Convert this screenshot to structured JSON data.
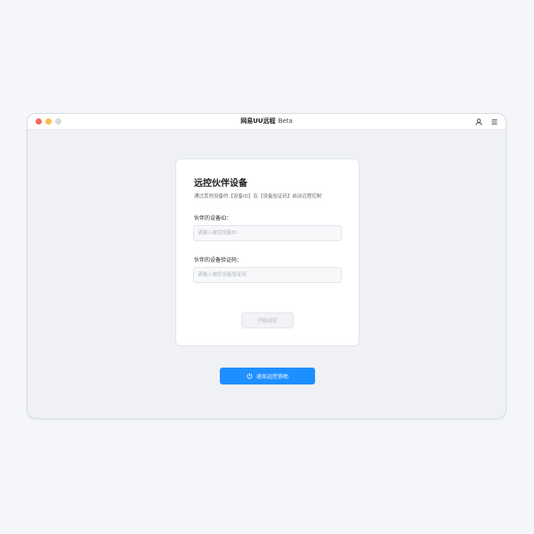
{
  "titlebar": {
    "app_name": "网易UU远程",
    "badge": "Beta",
    "icons": [
      "user-icon",
      "menu-icon"
    ]
  },
  "card": {
    "title": "远控伙伴设备",
    "subtitle": "通过其他设备的【设备ID】及【设备验证码】启动远程控制",
    "device_id_label": "伙伴的设备ID：",
    "device_id_placeholder": "请输入被控设备ID",
    "device_id_value": "",
    "verify_code_label": "伙伴的设备验证码：",
    "verify_code_placeholder": "请输入被控设备验证码",
    "verify_code_value": "",
    "start_button": "开始远控"
  },
  "exit_button": {
    "label": "退出远控协助",
    "icon": "power-icon"
  },
  "colors": {
    "accent": "#1e8fff",
    "close": "#f36b5e",
    "minimize": "#f7c04c",
    "maximize": "#d8d9dc"
  }
}
